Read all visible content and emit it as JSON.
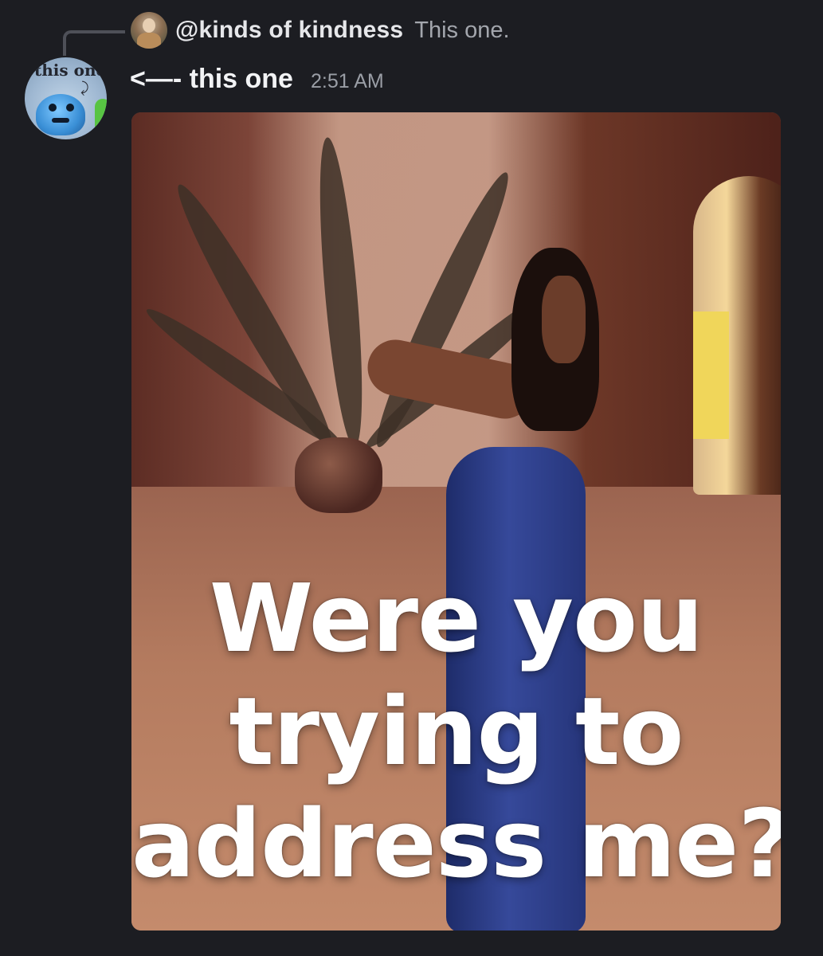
{
  "reply": {
    "username": "@kinds of kindness",
    "snippet": "This one."
  },
  "author_avatar": {
    "text": "this one"
  },
  "message": {
    "text": "<—- this one",
    "timestamp": "2:51 AM"
  },
  "attachment": {
    "type": "gif",
    "caption_lines": [
      "Were you",
      "trying to",
      "address me?"
    ]
  }
}
